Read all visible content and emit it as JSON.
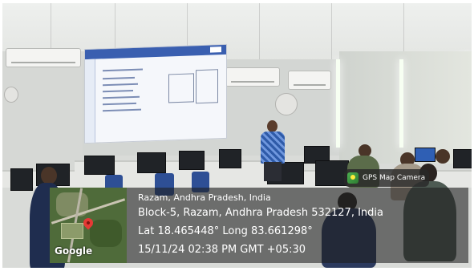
{
  "photo": {
    "scene": "classroom-presentation"
  },
  "camera_badge": {
    "app_name": "GPS Map Camera",
    "icon": "gps-camera-icon"
  },
  "location": {
    "place": "Razam, Andhra Pradesh, India",
    "address": "Block-5, Razam, Andhra Pradesh 532127, India",
    "coordinates": "Lat 18.465448° Long 83.661298°",
    "datetime": "15/11/24 02:38 PM GMT +05:30"
  },
  "map": {
    "attribution": "Google",
    "pin_icon": "map-pin-icon",
    "pin_color": "#e53935"
  }
}
